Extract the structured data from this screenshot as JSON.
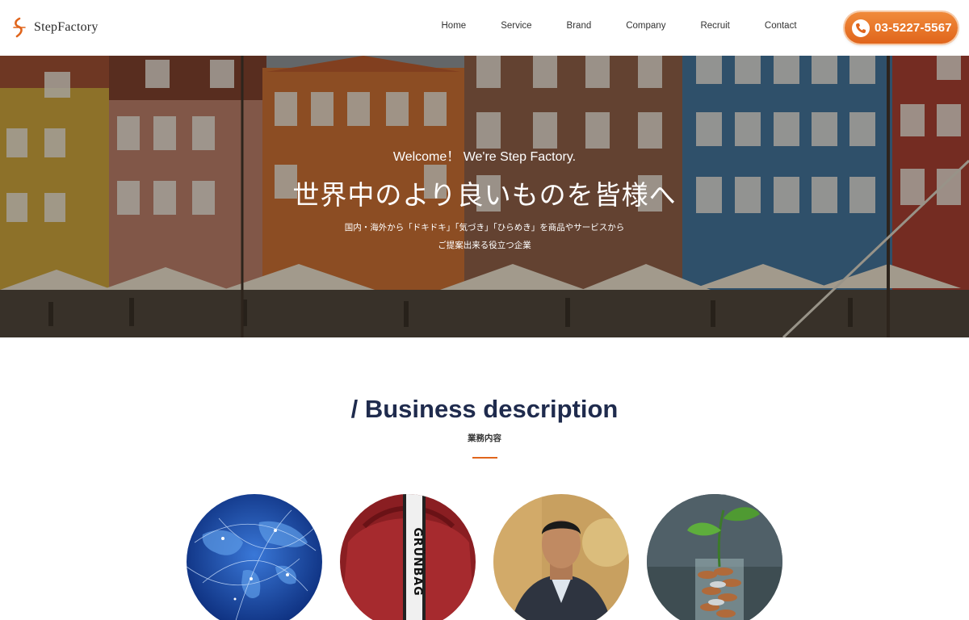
{
  "header": {
    "logo_text": "StepFactory",
    "nav": [
      "Home",
      "Service",
      "Brand",
      "Company",
      "Recruit",
      "Contact"
    ],
    "phone": "03-5227-5567"
  },
  "hero": {
    "welcome": "Welcome！ We're Step Factory.",
    "title": "世界中のより良いものを皆様へ",
    "sub1": "国内・海外から「ドキドキ」「気づき」「ひらめき」を商品やサービスから",
    "sub2": "ご提案出来る役立つ企業"
  },
  "section": {
    "title": "/ Business description",
    "subtitle": "業務内容"
  },
  "colors": {
    "accent": "#e0651c",
    "heading": "#1f2b4d"
  },
  "circles": [
    {
      "icon": "globe-network-image"
    },
    {
      "icon": "red-bag-image"
    },
    {
      "icon": "businessman-image"
    },
    {
      "icon": "coin-jar-plant-image"
    }
  ]
}
